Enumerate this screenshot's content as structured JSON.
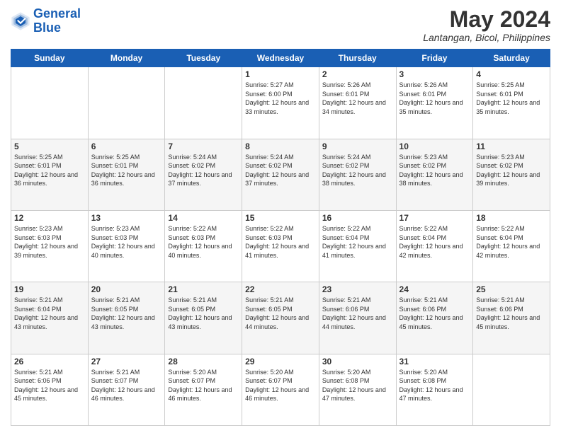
{
  "header": {
    "logo_line1": "General",
    "logo_line2": "Blue",
    "month": "May 2024",
    "location": "Lantangan, Bicol, Philippines"
  },
  "weekdays": [
    "Sunday",
    "Monday",
    "Tuesday",
    "Wednesday",
    "Thursday",
    "Friday",
    "Saturday"
  ],
  "weeks": [
    [
      {
        "day": "",
        "sunrise": "",
        "sunset": "",
        "daylight": ""
      },
      {
        "day": "",
        "sunrise": "",
        "sunset": "",
        "daylight": ""
      },
      {
        "day": "",
        "sunrise": "",
        "sunset": "",
        "daylight": ""
      },
      {
        "day": "1",
        "sunrise": "Sunrise: 5:27 AM",
        "sunset": "Sunset: 6:00 PM",
        "daylight": "Daylight: 12 hours and 33 minutes."
      },
      {
        "day": "2",
        "sunrise": "Sunrise: 5:26 AM",
        "sunset": "Sunset: 6:01 PM",
        "daylight": "Daylight: 12 hours and 34 minutes."
      },
      {
        "day": "3",
        "sunrise": "Sunrise: 5:26 AM",
        "sunset": "Sunset: 6:01 PM",
        "daylight": "Daylight: 12 hours and 35 minutes."
      },
      {
        "day": "4",
        "sunrise": "Sunrise: 5:25 AM",
        "sunset": "Sunset: 6:01 PM",
        "daylight": "Daylight: 12 hours and 35 minutes."
      }
    ],
    [
      {
        "day": "5",
        "sunrise": "Sunrise: 5:25 AM",
        "sunset": "Sunset: 6:01 PM",
        "daylight": "Daylight: 12 hours and 36 minutes."
      },
      {
        "day": "6",
        "sunrise": "Sunrise: 5:25 AM",
        "sunset": "Sunset: 6:01 PM",
        "daylight": "Daylight: 12 hours and 36 minutes."
      },
      {
        "day": "7",
        "sunrise": "Sunrise: 5:24 AM",
        "sunset": "Sunset: 6:02 PM",
        "daylight": "Daylight: 12 hours and 37 minutes."
      },
      {
        "day": "8",
        "sunrise": "Sunrise: 5:24 AM",
        "sunset": "Sunset: 6:02 PM",
        "daylight": "Daylight: 12 hours and 37 minutes."
      },
      {
        "day": "9",
        "sunrise": "Sunrise: 5:24 AM",
        "sunset": "Sunset: 6:02 PM",
        "daylight": "Daylight: 12 hours and 38 minutes."
      },
      {
        "day": "10",
        "sunrise": "Sunrise: 5:23 AM",
        "sunset": "Sunset: 6:02 PM",
        "daylight": "Daylight: 12 hours and 38 minutes."
      },
      {
        "day": "11",
        "sunrise": "Sunrise: 5:23 AM",
        "sunset": "Sunset: 6:02 PM",
        "daylight": "Daylight: 12 hours and 39 minutes."
      }
    ],
    [
      {
        "day": "12",
        "sunrise": "Sunrise: 5:23 AM",
        "sunset": "Sunset: 6:03 PM",
        "daylight": "Daylight: 12 hours and 39 minutes."
      },
      {
        "day": "13",
        "sunrise": "Sunrise: 5:23 AM",
        "sunset": "Sunset: 6:03 PM",
        "daylight": "Daylight: 12 hours and 40 minutes."
      },
      {
        "day": "14",
        "sunrise": "Sunrise: 5:22 AM",
        "sunset": "Sunset: 6:03 PM",
        "daylight": "Daylight: 12 hours and 40 minutes."
      },
      {
        "day": "15",
        "sunrise": "Sunrise: 5:22 AM",
        "sunset": "Sunset: 6:03 PM",
        "daylight": "Daylight: 12 hours and 41 minutes."
      },
      {
        "day": "16",
        "sunrise": "Sunrise: 5:22 AM",
        "sunset": "Sunset: 6:04 PM",
        "daylight": "Daylight: 12 hours and 41 minutes."
      },
      {
        "day": "17",
        "sunrise": "Sunrise: 5:22 AM",
        "sunset": "Sunset: 6:04 PM",
        "daylight": "Daylight: 12 hours and 42 minutes."
      },
      {
        "day": "18",
        "sunrise": "Sunrise: 5:22 AM",
        "sunset": "Sunset: 6:04 PM",
        "daylight": "Daylight: 12 hours and 42 minutes."
      }
    ],
    [
      {
        "day": "19",
        "sunrise": "Sunrise: 5:21 AM",
        "sunset": "Sunset: 6:04 PM",
        "daylight": "Daylight: 12 hours and 43 minutes."
      },
      {
        "day": "20",
        "sunrise": "Sunrise: 5:21 AM",
        "sunset": "Sunset: 6:05 PM",
        "daylight": "Daylight: 12 hours and 43 minutes."
      },
      {
        "day": "21",
        "sunrise": "Sunrise: 5:21 AM",
        "sunset": "Sunset: 6:05 PM",
        "daylight": "Daylight: 12 hours and 43 minutes."
      },
      {
        "day": "22",
        "sunrise": "Sunrise: 5:21 AM",
        "sunset": "Sunset: 6:05 PM",
        "daylight": "Daylight: 12 hours and 44 minutes."
      },
      {
        "day": "23",
        "sunrise": "Sunrise: 5:21 AM",
        "sunset": "Sunset: 6:06 PM",
        "daylight": "Daylight: 12 hours and 44 minutes."
      },
      {
        "day": "24",
        "sunrise": "Sunrise: 5:21 AM",
        "sunset": "Sunset: 6:06 PM",
        "daylight": "Daylight: 12 hours and 45 minutes."
      },
      {
        "day": "25",
        "sunrise": "Sunrise: 5:21 AM",
        "sunset": "Sunset: 6:06 PM",
        "daylight": "Daylight: 12 hours and 45 minutes."
      }
    ],
    [
      {
        "day": "26",
        "sunrise": "Sunrise: 5:21 AM",
        "sunset": "Sunset: 6:06 PM",
        "daylight": "Daylight: 12 hours and 45 minutes."
      },
      {
        "day": "27",
        "sunrise": "Sunrise: 5:21 AM",
        "sunset": "Sunset: 6:07 PM",
        "daylight": "Daylight: 12 hours and 46 minutes."
      },
      {
        "day": "28",
        "sunrise": "Sunrise: 5:20 AM",
        "sunset": "Sunset: 6:07 PM",
        "daylight": "Daylight: 12 hours and 46 minutes."
      },
      {
        "day": "29",
        "sunrise": "Sunrise: 5:20 AM",
        "sunset": "Sunset: 6:07 PM",
        "daylight": "Daylight: 12 hours and 46 minutes."
      },
      {
        "day": "30",
        "sunrise": "Sunrise: 5:20 AM",
        "sunset": "Sunset: 6:08 PM",
        "daylight": "Daylight: 12 hours and 47 minutes."
      },
      {
        "day": "31",
        "sunrise": "Sunrise: 5:20 AM",
        "sunset": "Sunset: 6:08 PM",
        "daylight": "Daylight: 12 hours and 47 minutes."
      },
      {
        "day": "",
        "sunrise": "",
        "sunset": "",
        "daylight": ""
      }
    ]
  ]
}
